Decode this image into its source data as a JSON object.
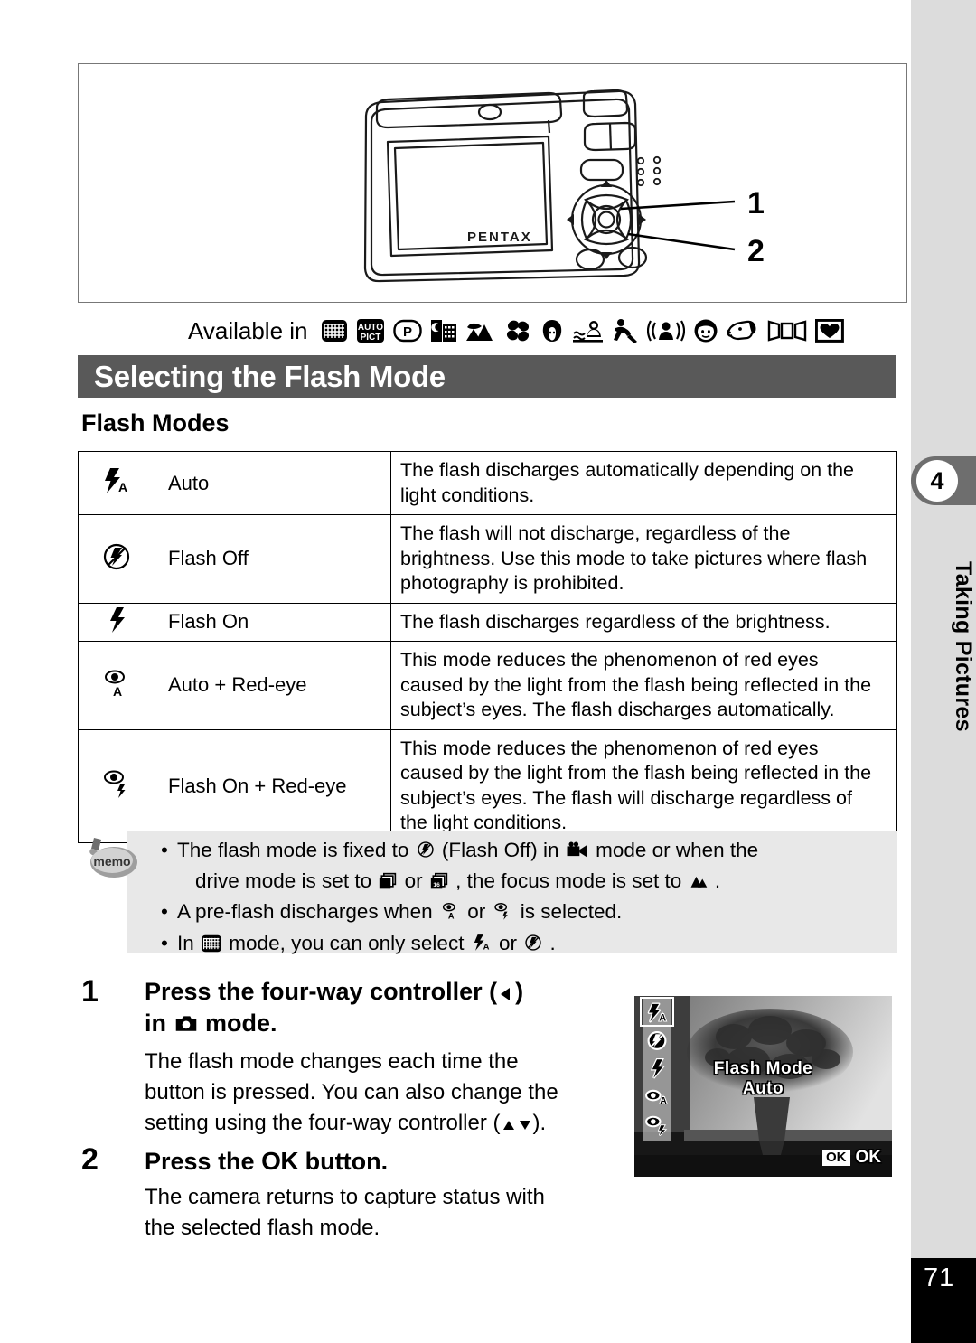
{
  "chapter": {
    "number": "4",
    "title": "Taking Pictures"
  },
  "page_number": "71",
  "available": {
    "label": "Available in",
    "modes": [
      "green-mode-icon",
      "auto-pict-icon",
      "program-mode-icon",
      "night-scene-icon",
      "landscape-icon",
      "flower-icon",
      "portrait-icon",
      "surf-and-snow-icon",
      "sport-icon",
      "digital-sr-icon",
      "kids-icon",
      "pet-icon",
      "panorama-icon",
      "frame-composite-icon"
    ]
  },
  "section": {
    "title": "Selecting the Flash Mode",
    "subheading": "Flash Modes"
  },
  "table": {
    "rows": [
      {
        "icon": "flash-auto-icon",
        "name": "Auto",
        "description_lines": [
          "The flash discharges automatically depending on the",
          "light conditions."
        ]
      },
      {
        "icon": "flash-off-icon",
        "name": "Flash Off",
        "description_lines": [
          "The flash will not discharge, regardless of the",
          "brightness. Use this mode to take pictures where flash",
          "photography is prohibited."
        ]
      },
      {
        "icon": "flash-on-icon",
        "name": "Flash On",
        "description_lines": [
          "The flash discharges regardless of the brightness."
        ]
      },
      {
        "icon": "auto-red-eye-icon",
        "name": "Auto + Red-eye",
        "description_lines": [
          "This mode reduces the phenomenon of red eyes",
          "caused by the light from the flash being reflected in the",
          "subject’s eyes. The flash discharges automatically."
        ]
      },
      {
        "icon": "flash-on-red-eye-icon",
        "name": "Flash On + Red-eye",
        "description_lines": [
          "This mode reduces the phenomenon of red eyes",
          "caused by the light from the flash being reflected in the",
          "subject’s eyes. The flash will discharge regardless of",
          "the light conditions."
        ]
      }
    ]
  },
  "memo": {
    "badge_label": "memo",
    "bullet": "•",
    "items": [
      {
        "line1_a": "The flash mode is fixed to",
        "line1_b": "(Flash Off) in",
        "line1_c": "mode or when the",
        "line2_a": "drive mode is set to",
        "line2_b": "or",
        "line2_c": ", the focus mode is set to",
        "line2_d": "."
      },
      {
        "line1_a": "A pre-flash discharges when",
        "line1_b": "or",
        "line1_c": "is selected."
      },
      {
        "line1_a": "In",
        "line1_b": "mode, you can only select",
        "line1_c": "or",
        "line1_d": "."
      }
    ]
  },
  "steps": [
    {
      "number": "1",
      "title_a": "Press the four-way controller (",
      "title_b": ")",
      "title_c": "in",
      "title_d": "mode.",
      "body_a": "The flash mode changes each time the",
      "body_b": "button is pressed. You can also change the",
      "body_c": "setting using the four-way controller (",
      "body_d": ")."
    },
    {
      "number": "2",
      "title_a": "Press the",
      "title_ok": "OK",
      "title_b": "button.",
      "body_a": "The camera returns to capture status with",
      "body_b": "the selected flash mode."
    }
  ],
  "camera_illustration": {
    "brand": "PENTAX",
    "callouts": [
      "1",
      "2"
    ]
  },
  "lcd": {
    "title": "Flash Mode",
    "value": "Auto",
    "ok_solid": "OK",
    "ok_outline": "OK",
    "icons": [
      "flash-auto-icon",
      "flash-off-icon",
      "flash-on-icon",
      "auto-red-eye-icon",
      "flash-on-red-eye-icon"
    ]
  },
  "colors": {
    "header_bar": "#595959",
    "sidebar": "#dcdcdc",
    "chapter_tab": "#6e6e6e",
    "memo_bg": "#e8e8e8",
    "page_block": "#000000"
  }
}
